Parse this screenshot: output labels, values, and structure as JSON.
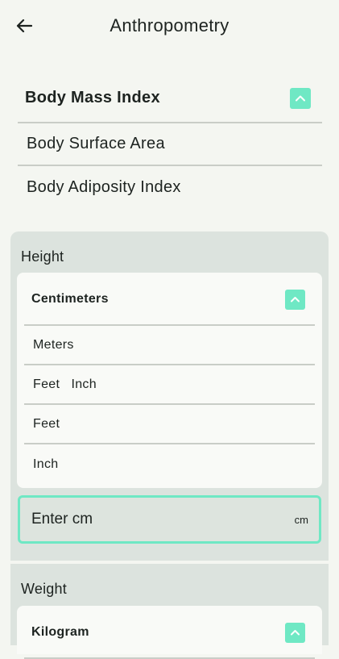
{
  "header": {
    "title": "Anthropometry",
    "back_icon": "arrow-left-icon"
  },
  "categories": [
    {
      "label": "Body Mass Index",
      "selected": true
    },
    {
      "label": "Body Surface Area",
      "selected": false
    },
    {
      "label": "Body Adiposity Index",
      "selected": false
    }
  ],
  "height_section": {
    "label": "Height",
    "units": [
      "Centimeters",
      "Meters",
      "Feet   Inch",
      "Feet",
      "Inch"
    ],
    "selected_unit": "Centimeters",
    "input": {
      "placeholder": "Enter cm",
      "value": "",
      "suffix": "cm"
    }
  },
  "weight_section": {
    "label": "Weight",
    "selected_unit": "Kilogram"
  },
  "colors": {
    "accent": "#6fe8c4",
    "panel": "#dce3de",
    "background": "#f4f6f1"
  }
}
